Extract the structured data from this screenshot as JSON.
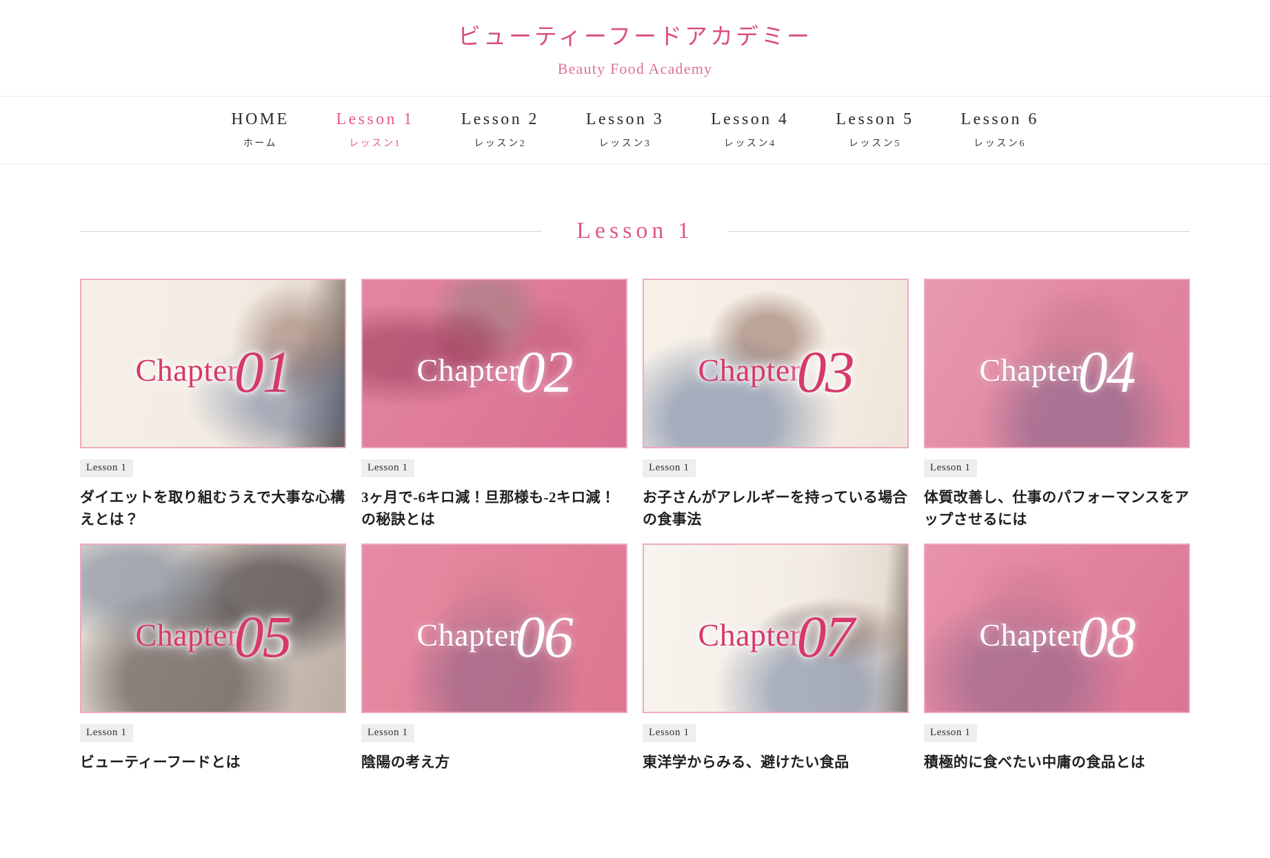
{
  "header": {
    "title_ja": "ビューティーフードアカデミー",
    "title_en": "Beauty Food Academy"
  },
  "nav": {
    "items": [
      {
        "en": "HOME",
        "ja": "ホーム",
        "active": false
      },
      {
        "en": "Lesson 1",
        "ja": "レッスン1",
        "active": true
      },
      {
        "en": "Lesson 2",
        "ja": "レッスン2",
        "active": false
      },
      {
        "en": "Lesson 3",
        "ja": "レッスン3",
        "active": false
      },
      {
        "en": "Lesson 4",
        "ja": "レッスン4",
        "active": false
      },
      {
        "en": "Lesson 5",
        "ja": "レッスン5",
        "active": false
      },
      {
        "en": "Lesson 6",
        "ja": "レッスン6",
        "active": false
      }
    ]
  },
  "section": {
    "title": "Lesson 1"
  },
  "colors": {
    "accent_pink": "#e05a80",
    "title_pink": "#d94f78",
    "chapter_pink": "#d6396a",
    "thumb_border": "#eda9bf",
    "badge_bg": "#eeeeee",
    "rule": "#d8d4d4"
  },
  "cards": [
    {
      "chapter_word": "Chapter",
      "chapter_num": "01",
      "badge": "Lesson 1",
      "title": "ダイエットを取り組むうえで大事な心構えとは？",
      "tone": "light"
    },
    {
      "chapter_word": "Chapter",
      "chapter_num": "02",
      "badge": "Lesson 1",
      "title": "3ヶ月で-6キロ減！旦那様も-2キロ減！の秘訣とは",
      "tone": "dark"
    },
    {
      "chapter_word": "Chapter",
      "chapter_num": "03",
      "badge": "Lesson 1",
      "title": "お子さんがアレルギーを持っている場合の食事法",
      "tone": "light"
    },
    {
      "chapter_word": "Chapter",
      "chapter_num": "04",
      "badge": "Lesson 1",
      "title": "体質改善し、仕事のパフォーマンスをアップさせるには",
      "tone": "dark"
    },
    {
      "chapter_word": "Chapter",
      "chapter_num": "05",
      "badge": "Lesson 1",
      "title": "ビューティーフードとは",
      "tone": "light"
    },
    {
      "chapter_word": "Chapter",
      "chapter_num": "06",
      "badge": "Lesson 1",
      "title": "陰陽の考え方",
      "tone": "dark"
    },
    {
      "chapter_word": "Chapter",
      "chapter_num": "07",
      "badge": "Lesson 1",
      "title": "東洋学からみる、避けたい食品",
      "tone": "light"
    },
    {
      "chapter_word": "Chapter",
      "chapter_num": "08",
      "badge": "Lesson 1",
      "title": "積極的に食べたい中庸の食品とは",
      "tone": "dark"
    }
  ]
}
